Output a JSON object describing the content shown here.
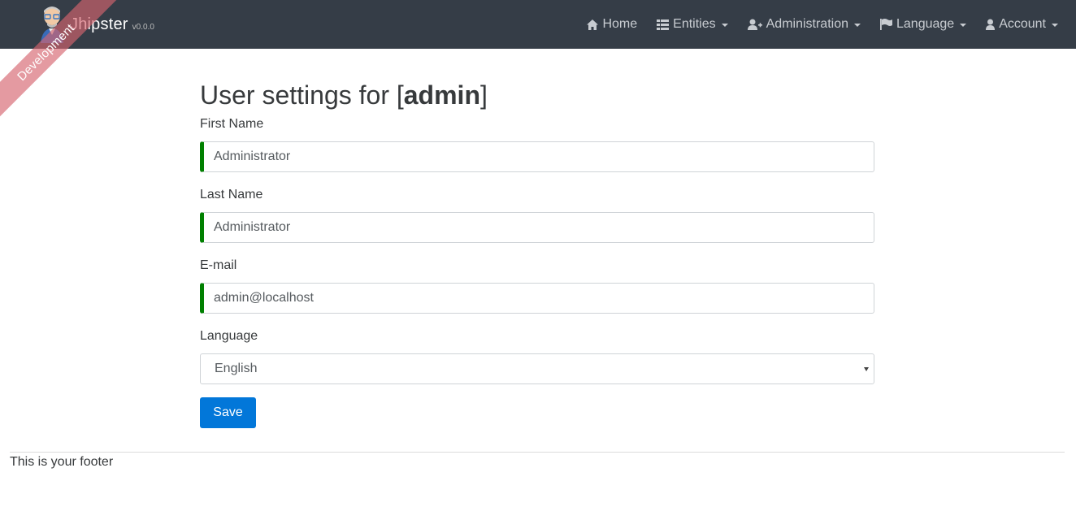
{
  "navbar": {
    "brand_title": "Jhipster",
    "brand_version": "v0.0.0",
    "items": [
      {
        "label": "Home",
        "icon": "home-icon"
      },
      {
        "label": "Entities",
        "icon": "list-icon"
      },
      {
        "label": "Administration",
        "icon": "user-plus-icon"
      },
      {
        "label": "Language",
        "icon": "flag-icon"
      },
      {
        "label": "Account",
        "icon": "user-icon"
      }
    ]
  },
  "ribbon": {
    "label": "Development"
  },
  "settings": {
    "title_prefix": "User settings for [",
    "username": "admin",
    "title_suffix": "]",
    "first_name_label": "First Name",
    "first_name_value": "Administrator",
    "last_name_label": "Last Name",
    "last_name_value": "Administrator",
    "email_label": "E-mail",
    "email_value": "admin@localhost",
    "language_label": "Language",
    "language_value": "English",
    "save_label": "Save"
  },
  "footer": {
    "text": "This is your footer"
  },
  "colors": {
    "navbar_bg": "#353d47",
    "valid_border": "#008000",
    "primary": "#0277d9",
    "ribbon": "#d6646e"
  }
}
